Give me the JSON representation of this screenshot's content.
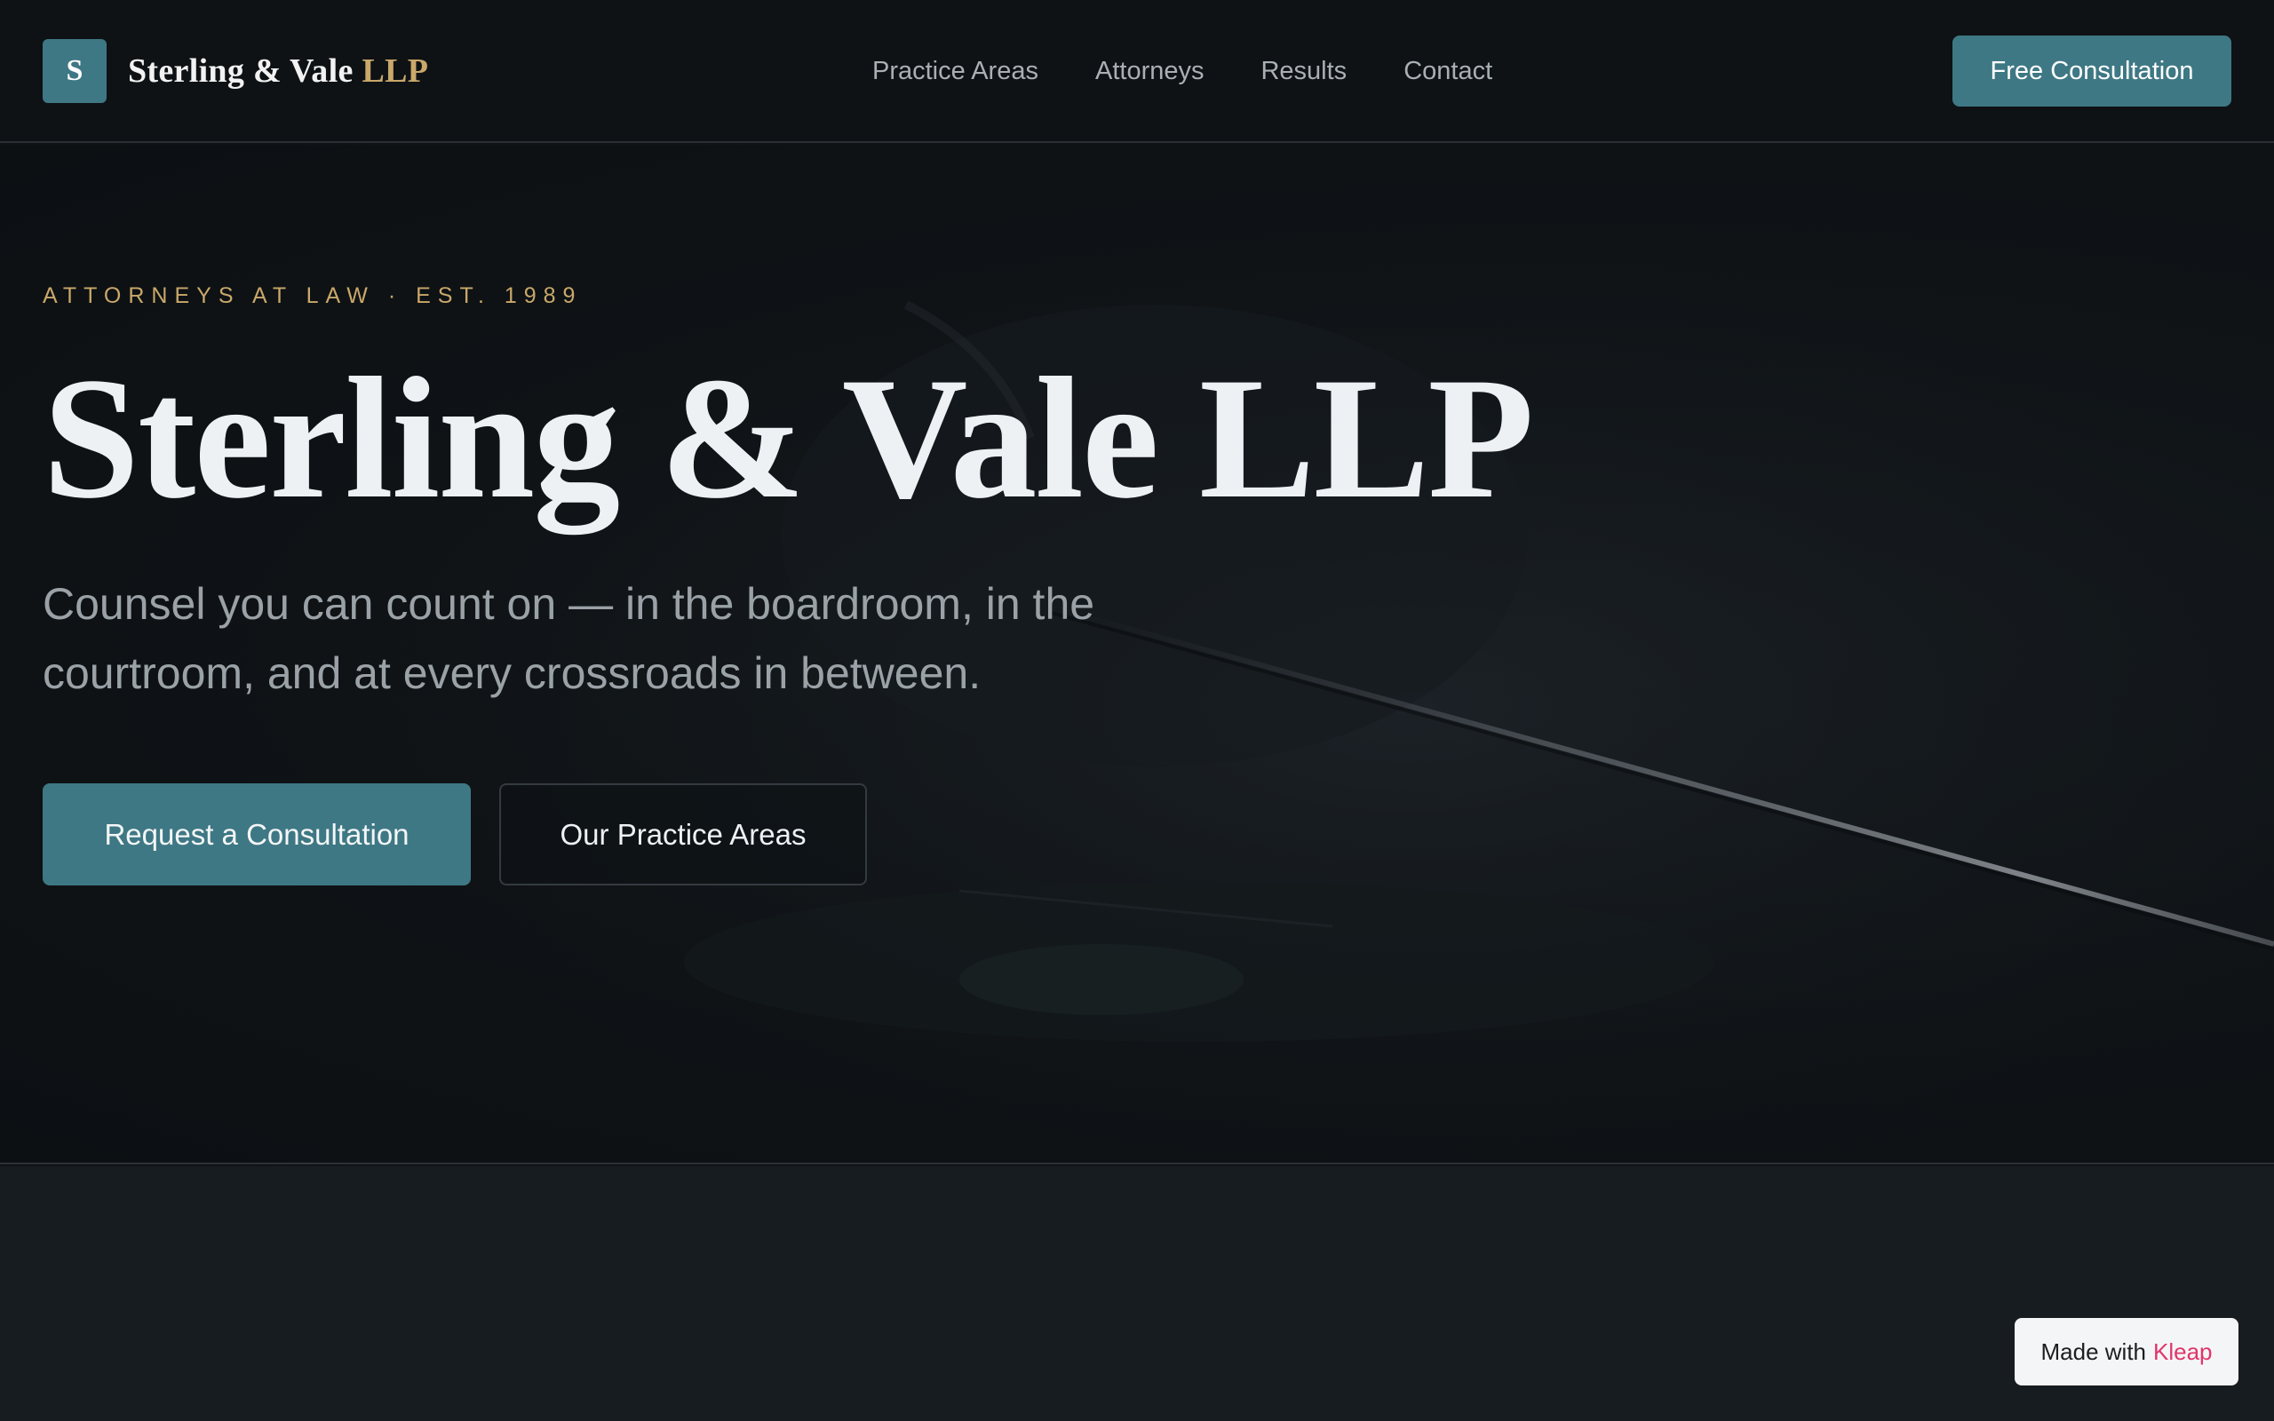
{
  "header": {
    "logo_letter": "S",
    "brand_name": "Sterling & Vale",
    "brand_suffix": "LLP",
    "nav": [
      "Practice Areas",
      "Attorneys",
      "Results",
      "Contact"
    ],
    "cta_label": "Free Consultation"
  },
  "hero": {
    "eyebrow": "ATTORNEYS AT LAW · EST. 1989",
    "title": "Sterling & Vale LLP",
    "subtitle": "Counsel you can count on — in the boardroom, in the courtroom, and at every crossroads in between.",
    "primary_button": "Request a Consultation",
    "secondary_button": "Our Practice Areas"
  },
  "badge": {
    "prefix": "Made with",
    "brand": "Kleap"
  },
  "colors": {
    "accent": "#3e7884",
    "gold": "#c9a86a",
    "background": "#0f1316",
    "kleap": "#e0356b"
  }
}
